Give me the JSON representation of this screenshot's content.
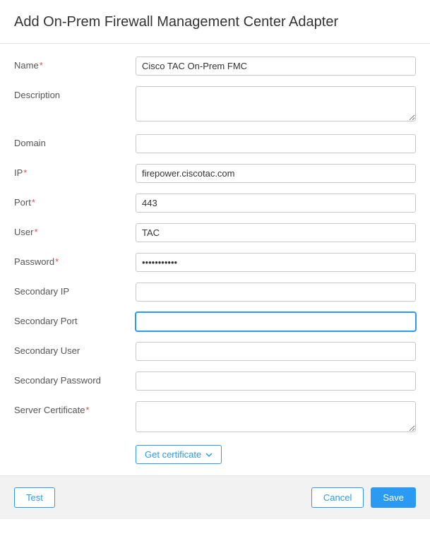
{
  "header": {
    "title": "Add On-Prem Firewall Management Center Adapter"
  },
  "fields": {
    "name": {
      "label": "Name",
      "required": true,
      "value": "Cisco TAC On-Prem FMC"
    },
    "description": {
      "label": "Description",
      "required": false,
      "value": ""
    },
    "domain": {
      "label": "Domain",
      "required": false,
      "value": ""
    },
    "ip": {
      "label": "IP",
      "required": true,
      "value": "firepower.ciscotac.com"
    },
    "port": {
      "label": "Port",
      "required": true,
      "value": "443"
    },
    "user": {
      "label": "User",
      "required": true,
      "value": "TAC"
    },
    "password": {
      "label": "Password",
      "required": true,
      "value": "•••••••••••"
    },
    "secondary_ip": {
      "label": "Secondary IP",
      "required": false,
      "value": ""
    },
    "secondary_port": {
      "label": "Secondary Port",
      "required": false,
      "value": "",
      "focused": true
    },
    "secondary_user": {
      "label": "Secondary User",
      "required": false,
      "value": ""
    },
    "secondary_password": {
      "label": "Secondary Password",
      "required": false,
      "value": ""
    },
    "server_certificate": {
      "label": "Server Certificate",
      "required": true,
      "value": ""
    }
  },
  "buttons": {
    "get_certificate": "Get certificate",
    "test": "Test",
    "cancel": "Cancel",
    "save": "Save"
  },
  "colors": {
    "accent": "#2b9af3",
    "required": "#d9534f",
    "footer_bg": "#f2f2f2"
  }
}
